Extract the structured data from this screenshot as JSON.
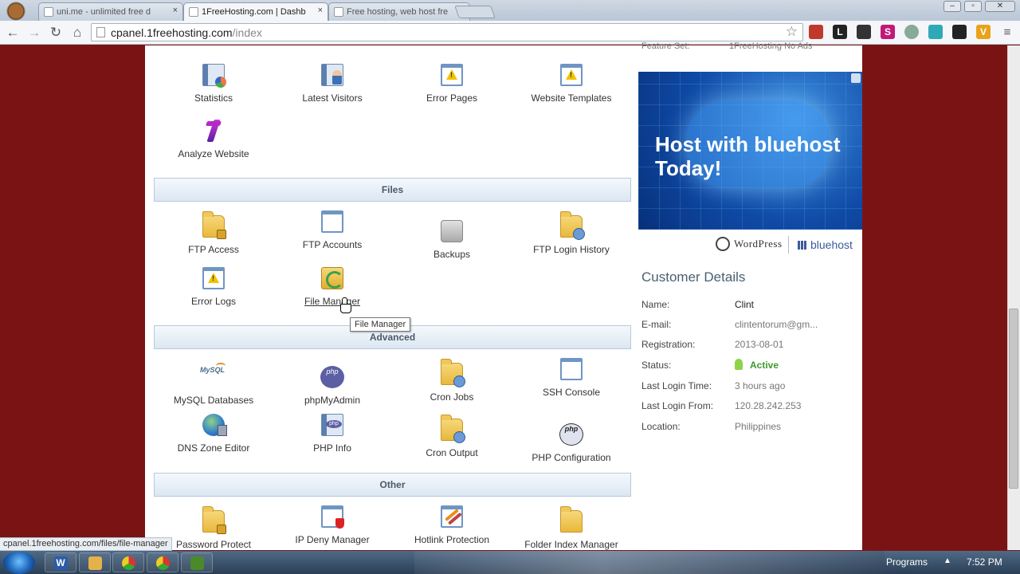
{
  "browser": {
    "tabs": [
      {
        "label": "uni.me - unlimited free d"
      },
      {
        "label": "1FreeHosting.com | Dashb"
      },
      {
        "label": "Free hosting, web host fre"
      }
    ],
    "url_host": "cpanel.1freehosting.com",
    "url_path": "/index",
    "close_glyph": "×",
    "status_url": "cpanel.1freehosting.com/files/file-manager",
    "extensions": [
      "L",
      "S",
      "V"
    ]
  },
  "sections": {
    "files": "Files",
    "advanced": "Advanced",
    "other": "Other"
  },
  "tools": {
    "stats": [
      "Statistics",
      "Latest Visitors",
      "Error Pages",
      "Website Templates",
      "Analyze Website"
    ],
    "files": [
      "FTP Access",
      "FTP Accounts",
      "Backups",
      "FTP Login History",
      "Error Logs",
      "File Manager"
    ],
    "advanced": [
      "MySQL Databases",
      "phpMyAdmin",
      "Cron Jobs",
      "SSH Console",
      "DNS Zone Editor",
      "PHP Info",
      "Cron Output",
      "PHP Configuration"
    ],
    "other": [
      "Password Protect",
      "IP Deny Manager",
      "Hotlink Protection",
      "Folder Index Manager"
    ]
  },
  "icon_text": {
    "mysql": "MySQL",
    "php": "php"
  },
  "tooltip": "File Manager",
  "feature": {
    "label": "Feature Set:",
    "value": "1FreeHosting No Ads"
  },
  "ad": {
    "headline": "Host with bluehost Today!",
    "wordpress": "WordPress",
    "bluehost": "bluehost"
  },
  "customer": {
    "title": "Customer Details",
    "rows": [
      {
        "label": "Name:",
        "value": "Clint"
      },
      {
        "label": "E-mail:",
        "value": "clintentorum@gm..."
      },
      {
        "label": "Registration:",
        "value": "2013-08-01"
      },
      {
        "label": "Status:",
        "value": "Active"
      },
      {
        "label": "Last Login Time:",
        "value": "3 hours ago"
      },
      {
        "label": "Last Login From:",
        "value": "120.28.242.253"
      },
      {
        "label": "Location:",
        "value": "Philippines"
      }
    ]
  },
  "taskbar": {
    "programs": "Programs",
    "clock": "7:52 PM",
    "apps": [
      "W",
      "",
      "",
      "",
      ""
    ]
  },
  "colors": {
    "page_background": "#7a1414",
    "section_header": "#dce7f2",
    "active_status": "#3a9a2a"
  }
}
